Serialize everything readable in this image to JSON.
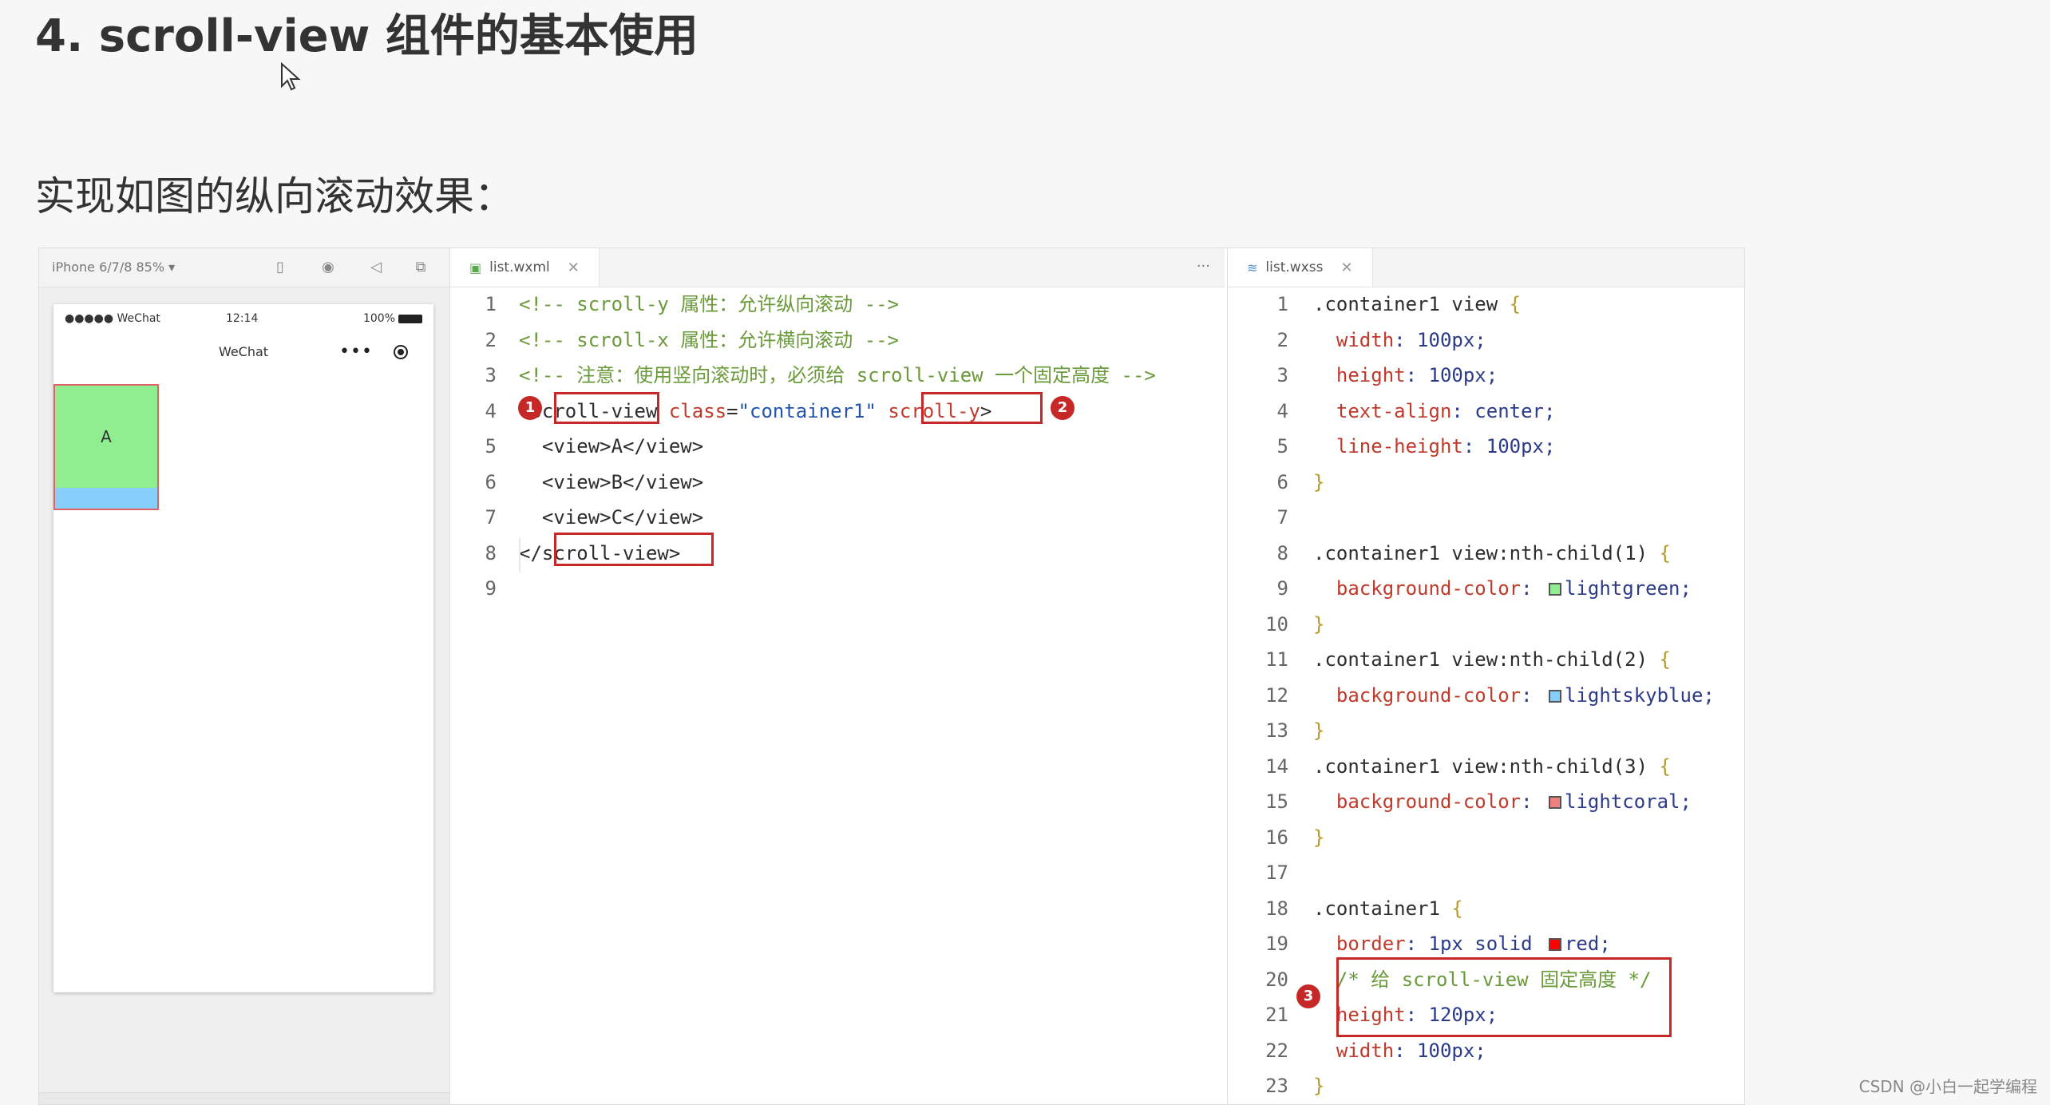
{
  "slide": {
    "title": "4. scroll-view 组件的基本使用",
    "subtitle": "实现如图的纵向滚动效果："
  },
  "simulator": {
    "device": "iPhone 6/7/8 85% ▾",
    "status": {
      "carrier": "●●●●● WeChat",
      "time": "12:14",
      "battery": "100%"
    },
    "nav_title": "WeChat",
    "capsule_dots": "•••",
    "scroll_item_a": "A"
  },
  "editor_wxml": {
    "tab": "list.wxml",
    "lines": [
      {
        "n": "1",
        "segs": [
          {
            "t": "<!-- scroll-y 属性：允许纵向滚动 -->",
            "c": "comment"
          }
        ]
      },
      {
        "n": "2",
        "segs": [
          {
            "t": "<!-- scroll-x 属性：允许横向滚动 -->",
            "c": "comment"
          }
        ]
      },
      {
        "n": "3",
        "segs": [
          {
            "t": "<!-- 注意：使用竖向滚动时，必须给 scroll-view 一个固定高度 -->",
            "c": "comment"
          }
        ]
      },
      {
        "n": "4",
        "segs": [
          {
            "t": "<scroll-view ",
            "c": "tag"
          },
          {
            "t": "class",
            "c": "attr"
          },
          {
            "t": "=",
            "c": "tag"
          },
          {
            "t": "\"container1\"",
            "c": "str"
          },
          {
            "t": " ",
            "c": "tag"
          },
          {
            "t": "scroll-y",
            "c": "attr"
          },
          {
            "t": ">",
            "c": "tag"
          }
        ]
      },
      {
        "n": "5",
        "segs": [
          {
            "t": "  <view>A</view>",
            "c": "tag"
          }
        ]
      },
      {
        "n": "6",
        "segs": [
          {
            "t": "  <view>B</view>",
            "c": "tag"
          }
        ]
      },
      {
        "n": "7",
        "segs": [
          {
            "t": "  <view>C</view>",
            "c": "tag"
          }
        ]
      },
      {
        "n": "8",
        "segs": [
          {
            "t": "</scroll-view>",
            "c": "tag"
          }
        ]
      },
      {
        "n": "9",
        "segs": []
      }
    ]
  },
  "editor_wxss": {
    "tab": "list.wxss",
    "lines": [
      {
        "n": "1",
        "segs": [
          {
            "t": ".container1 view ",
            "c": "tag"
          },
          {
            "t": "{",
            "c": "brace"
          }
        ]
      },
      {
        "n": "2",
        "segs": [
          {
            "t": "  width",
            "c": "prop"
          },
          {
            "t": ": 100px;",
            "c": "val"
          }
        ]
      },
      {
        "n": "3",
        "segs": [
          {
            "t": "  height",
            "c": "prop"
          },
          {
            "t": ": 100px;",
            "c": "val"
          }
        ]
      },
      {
        "n": "4",
        "segs": [
          {
            "t": "  text-align",
            "c": "prop"
          },
          {
            "t": ": center;",
            "c": "val"
          }
        ]
      },
      {
        "n": "5",
        "segs": [
          {
            "t": "  line-height",
            "c": "prop"
          },
          {
            "t": ": 100px;",
            "c": "val"
          }
        ]
      },
      {
        "n": "6",
        "segs": [
          {
            "t": "}",
            "c": "brace"
          }
        ]
      },
      {
        "n": "7",
        "segs": []
      },
      {
        "n": "8",
        "segs": [
          {
            "t": ".container1 view:nth-child(1) ",
            "c": "tag"
          },
          {
            "t": "{",
            "c": "brace"
          }
        ]
      },
      {
        "n": "9",
        "segs": [
          {
            "t": "  background-color",
            "c": "prop"
          },
          {
            "t": ": ",
            "c": "val"
          },
          {
            "sw": "lightgreen"
          },
          {
            "t": "lightgreen;",
            "c": "val"
          }
        ]
      },
      {
        "n": "10",
        "segs": [
          {
            "t": "}",
            "c": "brace"
          }
        ]
      },
      {
        "n": "11",
        "segs": [
          {
            "t": ".container1 view:nth-child(2) ",
            "c": "tag"
          },
          {
            "t": "{",
            "c": "brace"
          }
        ]
      },
      {
        "n": "12",
        "segs": [
          {
            "t": "  background-color",
            "c": "prop"
          },
          {
            "t": ": ",
            "c": "val"
          },
          {
            "sw": "lightskyblue"
          },
          {
            "t": "lightskyblue;",
            "c": "val"
          }
        ]
      },
      {
        "n": "13",
        "segs": [
          {
            "t": "}",
            "c": "brace"
          }
        ]
      },
      {
        "n": "14",
        "segs": [
          {
            "t": ".container1 view:nth-child(3) ",
            "c": "tag"
          },
          {
            "t": "{",
            "c": "brace"
          }
        ]
      },
      {
        "n": "15",
        "segs": [
          {
            "t": "  background-color",
            "c": "prop"
          },
          {
            "t": ": ",
            "c": "val"
          },
          {
            "sw": "lightcoral"
          },
          {
            "t": "lightcoral;",
            "c": "val"
          }
        ]
      },
      {
        "n": "16",
        "segs": [
          {
            "t": "}",
            "c": "brace"
          }
        ]
      },
      {
        "n": "17",
        "segs": []
      },
      {
        "n": "18",
        "segs": [
          {
            "t": ".container1 ",
            "c": "tag"
          },
          {
            "t": "{",
            "c": "brace"
          }
        ]
      },
      {
        "n": "19",
        "segs": [
          {
            "t": "  border",
            "c": "prop"
          },
          {
            "t": ": 1px solid ",
            "c": "val"
          },
          {
            "sw": "red"
          },
          {
            "t": "red;",
            "c": "val"
          }
        ]
      },
      {
        "n": "20",
        "segs": [
          {
            "t": "  /* 给 scroll-view 固定高度 */",
            "c": "comment"
          }
        ]
      },
      {
        "n": "21",
        "segs": [
          {
            "t": "  height",
            "c": "prop"
          },
          {
            "t": ": 120px;",
            "c": "val"
          }
        ]
      },
      {
        "n": "22",
        "segs": [
          {
            "t": "  width",
            "c": "prop"
          },
          {
            "t": ": 100px;",
            "c": "val"
          }
        ]
      },
      {
        "n": "23",
        "segs": [
          {
            "t": "}",
            "c": "brace"
          }
        ]
      }
    ]
  },
  "badges": [
    "1",
    "2",
    "3"
  ],
  "colors": {
    "highlight": "#c62828",
    "comment": "#6a9a3a"
  },
  "watermark": "CSDN @小白一起学编程"
}
